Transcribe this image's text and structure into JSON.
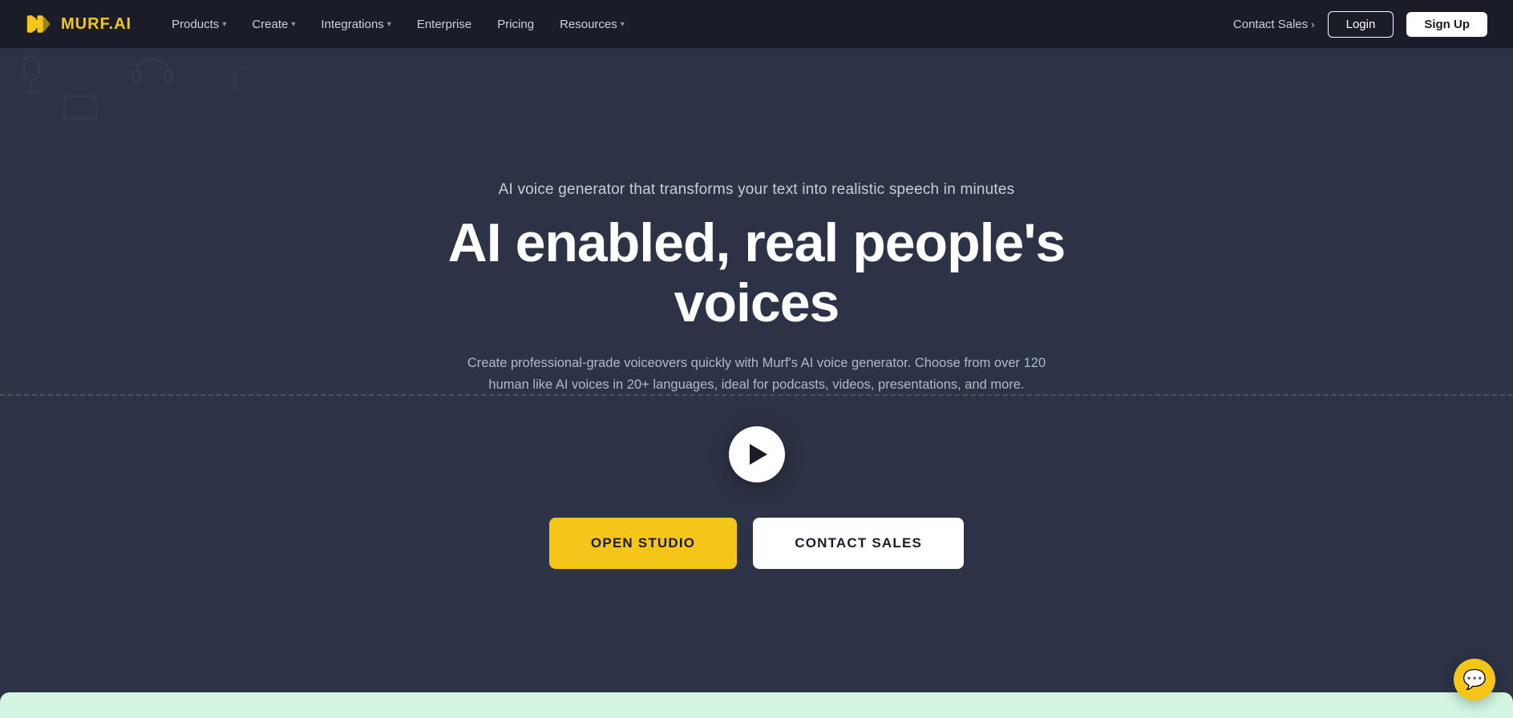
{
  "brand": {
    "logo_text": "MURF",
    "logo_suffix": ".AI"
  },
  "navbar": {
    "products_label": "Products",
    "create_label": "Create",
    "integrations_label": "Integrations",
    "enterprise_label": "Enterprise",
    "pricing_label": "Pricing",
    "resources_label": "Resources",
    "contact_sales_label": "Contact Sales",
    "login_label": "Login",
    "signup_label": "Sign Up"
  },
  "hero": {
    "subtitle": "AI voice generator that transforms your text into realistic speech in minutes",
    "title": "AI enabled, real people's voices",
    "description": "Create professional-grade voiceovers quickly with Murf's AI voice generator. Choose from over 120 human like AI voices in 20+ languages, ideal for podcasts, videos, presentations, and more.",
    "open_studio_label": "OPEN STUDIO",
    "contact_sales_label": "CONTACT SALES"
  },
  "chat": {
    "icon": "💬"
  }
}
